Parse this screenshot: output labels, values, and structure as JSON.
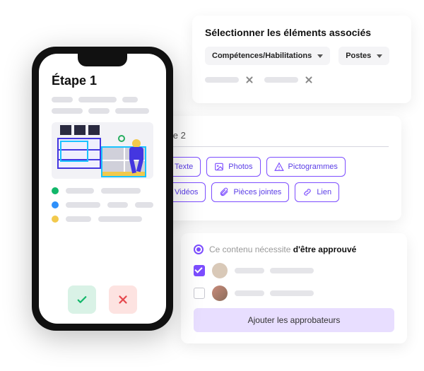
{
  "card1": {
    "title": "Sélectionner les éléments associés",
    "dropdowns": [
      {
        "label": "Compétences/Habilitations"
      },
      {
        "label": "Postes"
      }
    ]
  },
  "card2": {
    "step_input_value": "Étape 2",
    "tools": [
      "Texte",
      "Photos",
      "Pictogrammes",
      "Vidéos",
      "Pièces jointes",
      "Lien"
    ]
  },
  "card3": {
    "approve_text_grey": "Ce contenu nécessite ",
    "approve_text_bold": "d'être approuvé",
    "cta_label": "Ajouter les approbateurs"
  },
  "phone": {
    "title": "Étape 1"
  }
}
